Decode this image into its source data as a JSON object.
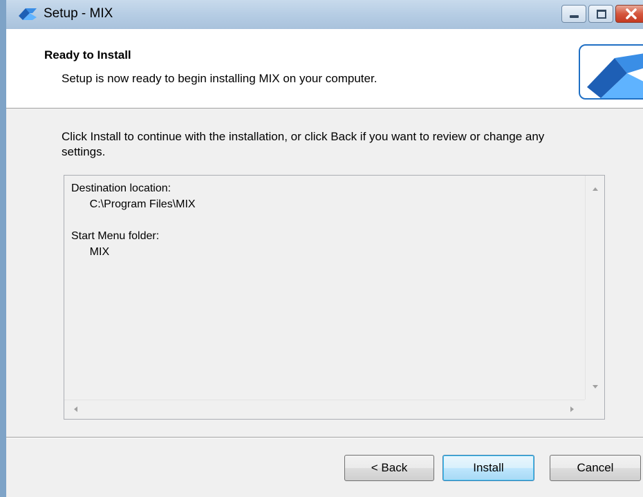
{
  "window": {
    "title": "Setup - MIX",
    "controls": {
      "minimize": "minimize",
      "maximize": "maximize",
      "close": "close"
    }
  },
  "header": {
    "title": "Ready to Install",
    "subtitle": "Setup is now ready to begin installing MIX on your computer."
  },
  "body": {
    "instruction": "Click Install to continue with the installation, or click Back if you want to review or change any settings."
  },
  "summary": {
    "destination_label": "Destination location:",
    "destination_value": "C:\\Program Files\\MIX",
    "start_menu_label": "Start Menu folder:",
    "start_menu_value": "MIX"
  },
  "buttons": {
    "back": "< Back",
    "install": "Install",
    "cancel": "Cancel"
  },
  "colors": {
    "accent": "#1f6fc4",
    "titlebar": "#b6cde4",
    "close": "#c43a22"
  }
}
